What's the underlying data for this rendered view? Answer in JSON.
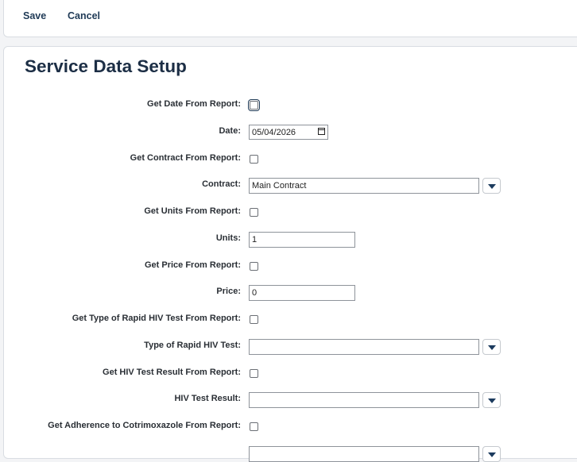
{
  "toolbar": {
    "save_label": "Save",
    "cancel_label": "Cancel"
  },
  "page": {
    "title": "Service Data Setup"
  },
  "form": {
    "get_date_label": "Get Date From Report:",
    "date_label": "Date:",
    "date_value": "05/04/2026",
    "get_contract_label": "Get Contract From Report:",
    "contract_label": "Contract:",
    "contract_value": "Main Contract",
    "get_units_label": "Get Units From Report:",
    "units_label": "Units:",
    "units_value": "1",
    "get_price_label": "Get Price From Report:",
    "price_label": "Price:",
    "price_value": "0",
    "get_hiv_type_label": "Get Type of Rapid HIV Test From Report:",
    "hiv_type_label": "Type of Rapid HIV Test:",
    "hiv_type_value": "",
    "get_hiv_result_label": "Get HIV Test Result From Report:",
    "hiv_result_label": "HIV Test Result:",
    "hiv_result_value": "",
    "get_adherence_label": "Get Adherence to Cotrimoxazole From Report:"
  },
  "icons": {
    "dropdown": "chevron-down-icon",
    "calendar": "calendar-icon"
  },
  "colors": {
    "accent": "#1c3b5e",
    "title": "#1c2e45"
  }
}
